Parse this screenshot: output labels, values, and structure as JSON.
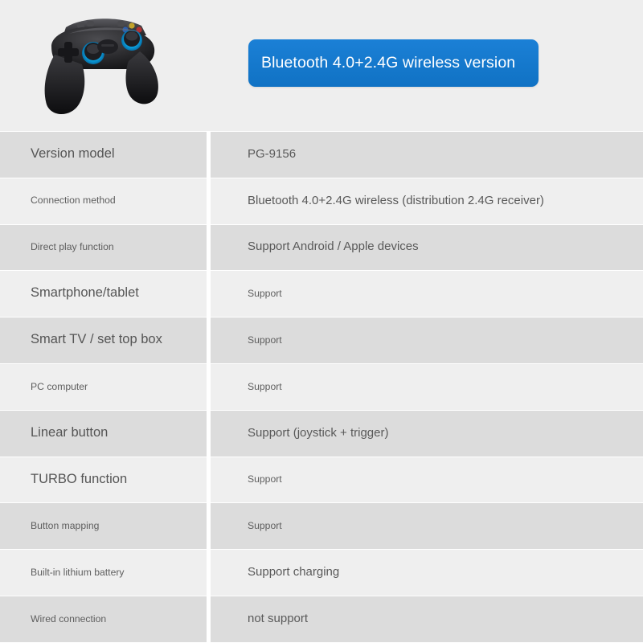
{
  "hero": {
    "background_color": "#eeeeee",
    "product_image": {
      "alt": "black wireless gamepad controller with blue illuminated joystick rings",
      "icon": "gamepad-icon"
    },
    "banner": {
      "text": "Bluetooth 4.0+2.4G wireless version",
      "background_color": "#1579ce",
      "text_color": "#ffffff"
    }
  },
  "spec_table": {
    "columns": [
      "label",
      "value"
    ],
    "row_colors": [
      "#dcdcdc",
      "#efefef"
    ],
    "rows": [
      {
        "label": "Version model",
        "value": "PG-9156",
        "label_size": "lg",
        "value_size": "lg"
      },
      {
        "label": "Connection method",
        "value": "Bluetooth 4.0+2.4G wireless (distribution 2.4G receiver)",
        "label_size": "sm",
        "value_size": "lg"
      },
      {
        "label": "Direct play function",
        "value": "Support Android / Apple devices",
        "label_size": "sm",
        "value_size": "lg"
      },
      {
        "label": "Smartphone/tablet",
        "value": "Support",
        "label_size": "lg",
        "value_size": "sm"
      },
      {
        "label": "Smart TV / set top box",
        "value": "Support",
        "label_size": "lg",
        "value_size": "sm"
      },
      {
        "label": "PC computer",
        "value": "Support",
        "label_size": "sm",
        "value_size": "sm"
      },
      {
        "label": "Linear button",
        "value": "Support (joystick + trigger)",
        "label_size": "lg",
        "value_size": "lg"
      },
      {
        "label": "TURBO function",
        "value": "Support",
        "label_size": "lg",
        "value_size": "sm"
      },
      {
        "label": "Button mapping",
        "value": "Support",
        "label_size": "sm",
        "value_size": "sm"
      },
      {
        "label": "Built-in lithium battery",
        "value": "Support charging",
        "label_size": "sm",
        "value_size": "lg"
      },
      {
        "label": "Wired connection",
        "value": "not support",
        "label_size": "sm",
        "value_size": "lg"
      }
    ]
  }
}
